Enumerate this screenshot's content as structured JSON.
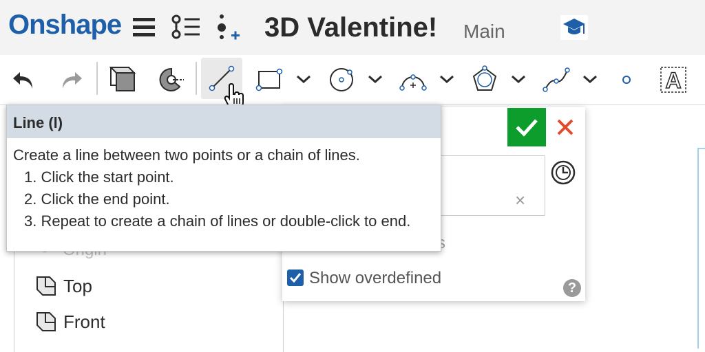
{
  "header": {
    "logo": "Onshape",
    "doc_title": "3D Valentine!",
    "branch": "Main"
  },
  "tooltip": {
    "title": "Line (l)",
    "description": "Create a line between two points or a chain of lines.",
    "steps": [
      "1. Click the start point.",
      "2. Click the end point.",
      "3. Repeat to create a chain of lines or double-click to end."
    ]
  },
  "features": {
    "origin": "Origin",
    "planes": [
      "Top",
      "Front"
    ]
  },
  "sketch_dialog": {
    "partial_label": "s",
    "clear_glyph": "×",
    "show_overdefined_label": "Show overdefined",
    "show_overdefined_checked": true,
    "help_glyph": "?"
  },
  "colors": {
    "brand": "#1d5fa8",
    "accept": "#0c9d2c",
    "cancel": "#e04b2b"
  },
  "icons": {
    "toolbar": [
      "undo-icon",
      "redo-icon",
      "extrude-icon",
      "revolve-icon",
      "line-icon",
      "rectangle-icon",
      "circle-icon",
      "arc-icon",
      "polygon-icon",
      "spline-icon",
      "point-icon",
      "text-icon"
    ]
  }
}
